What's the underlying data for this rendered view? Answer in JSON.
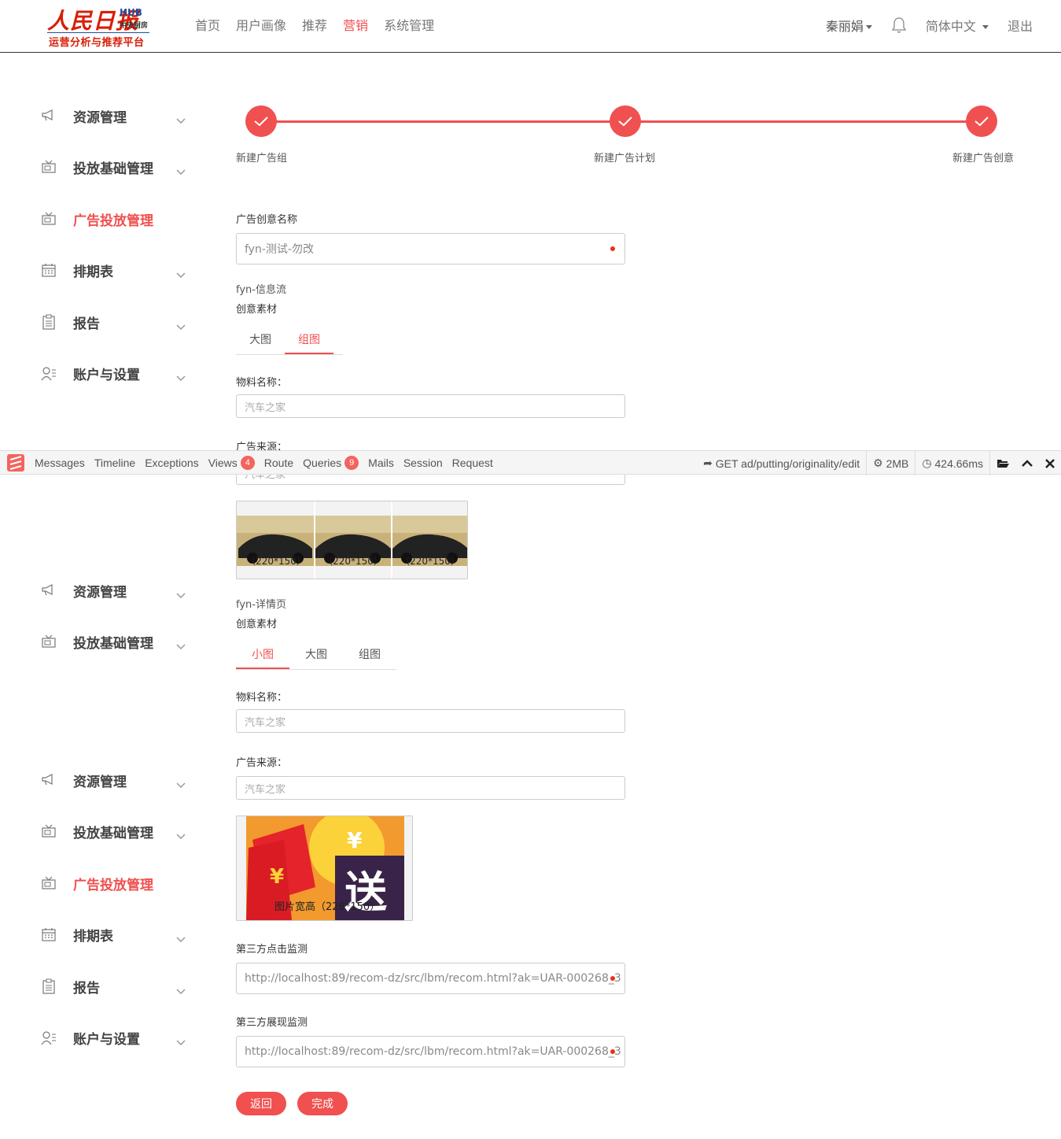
{
  "header": {
    "logo_main": "人民日报",
    "logo_hub": "HUB",
    "logo_sub_small": "中央厨房",
    "logo_sub": "运营分析与推荐平台",
    "nav": [
      "首页",
      "用户画像",
      "推荐",
      "营销",
      "系统管理"
    ],
    "active_nav": "营销",
    "user": "秦丽娟",
    "language": "简体中文",
    "logout": "退出"
  },
  "sidebar_groups": [
    [
      "资源管理",
      "投放基础管理",
      "广告投放管理",
      "排期表",
      "报告",
      "账户与设置"
    ],
    [
      "资源管理",
      "投放基础管理"
    ],
    [
      "资源管理",
      "投放基础管理",
      "广告投放管理",
      "排期表",
      "报告",
      "账户与设置"
    ]
  ],
  "steps": [
    "新建广告组",
    "新建广告计划",
    "新建广告创意"
  ],
  "form": {
    "creative_name_label": "广告创意名称",
    "creative_name_value": "fyn-测试-勿改",
    "section1": {
      "title": "fyn-信息流",
      "material_label": "创意素材",
      "tabs": [
        "大图",
        "组图"
      ],
      "active_tab": "组图",
      "material_name_label": "物料名称：",
      "material_name_placeholder": "汽车之家",
      "ad_source_label": "广告来源：",
      "ad_source_placeholder": "汽车之家",
      "image_captions": [
        "图片宽高（220*150）",
        "图片宽高（220*150）",
        "图片宽高（220*150）"
      ]
    },
    "section2": {
      "title": "fyn-详情页",
      "material_label": "创意素材",
      "tabs": [
        "小图",
        "大图",
        "组图"
      ],
      "active_tab": "小图",
      "material_name_label": "物料名称：",
      "material_name_placeholder": "汽车之家",
      "ad_source_label": "广告来源：",
      "ad_source_placeholder": "汽车之家",
      "image_caption": "图片宽高（228*150）"
    },
    "click_monitor_label": "第三方点击监测",
    "click_monitor_value": "http://localhost:89/recom-dz/src/lbm/recom.html?ak=UAR-000268_3",
    "impression_monitor_label": "第三方展现监测",
    "impression_monitor_value": "http://localhost:89/recom-dz/src/lbm/recom.html?ak=UAR-000268_3",
    "back_button": "返回",
    "finish_button": "完成"
  },
  "debugbar": {
    "tabs": [
      "Messages",
      "Timeline",
      "Exceptions",
      "Views",
      "Route",
      "Queries",
      "Mails",
      "Session",
      "Request"
    ],
    "views_count": "4",
    "queries_count": "9",
    "route": "GET ad/putting/originality/edit",
    "memory": "2MB",
    "time": "424.66ms"
  },
  "colors": {
    "accent": "#f0504f",
    "brand_red": "#d81e06",
    "brand_blue": "#1d4fa0"
  }
}
